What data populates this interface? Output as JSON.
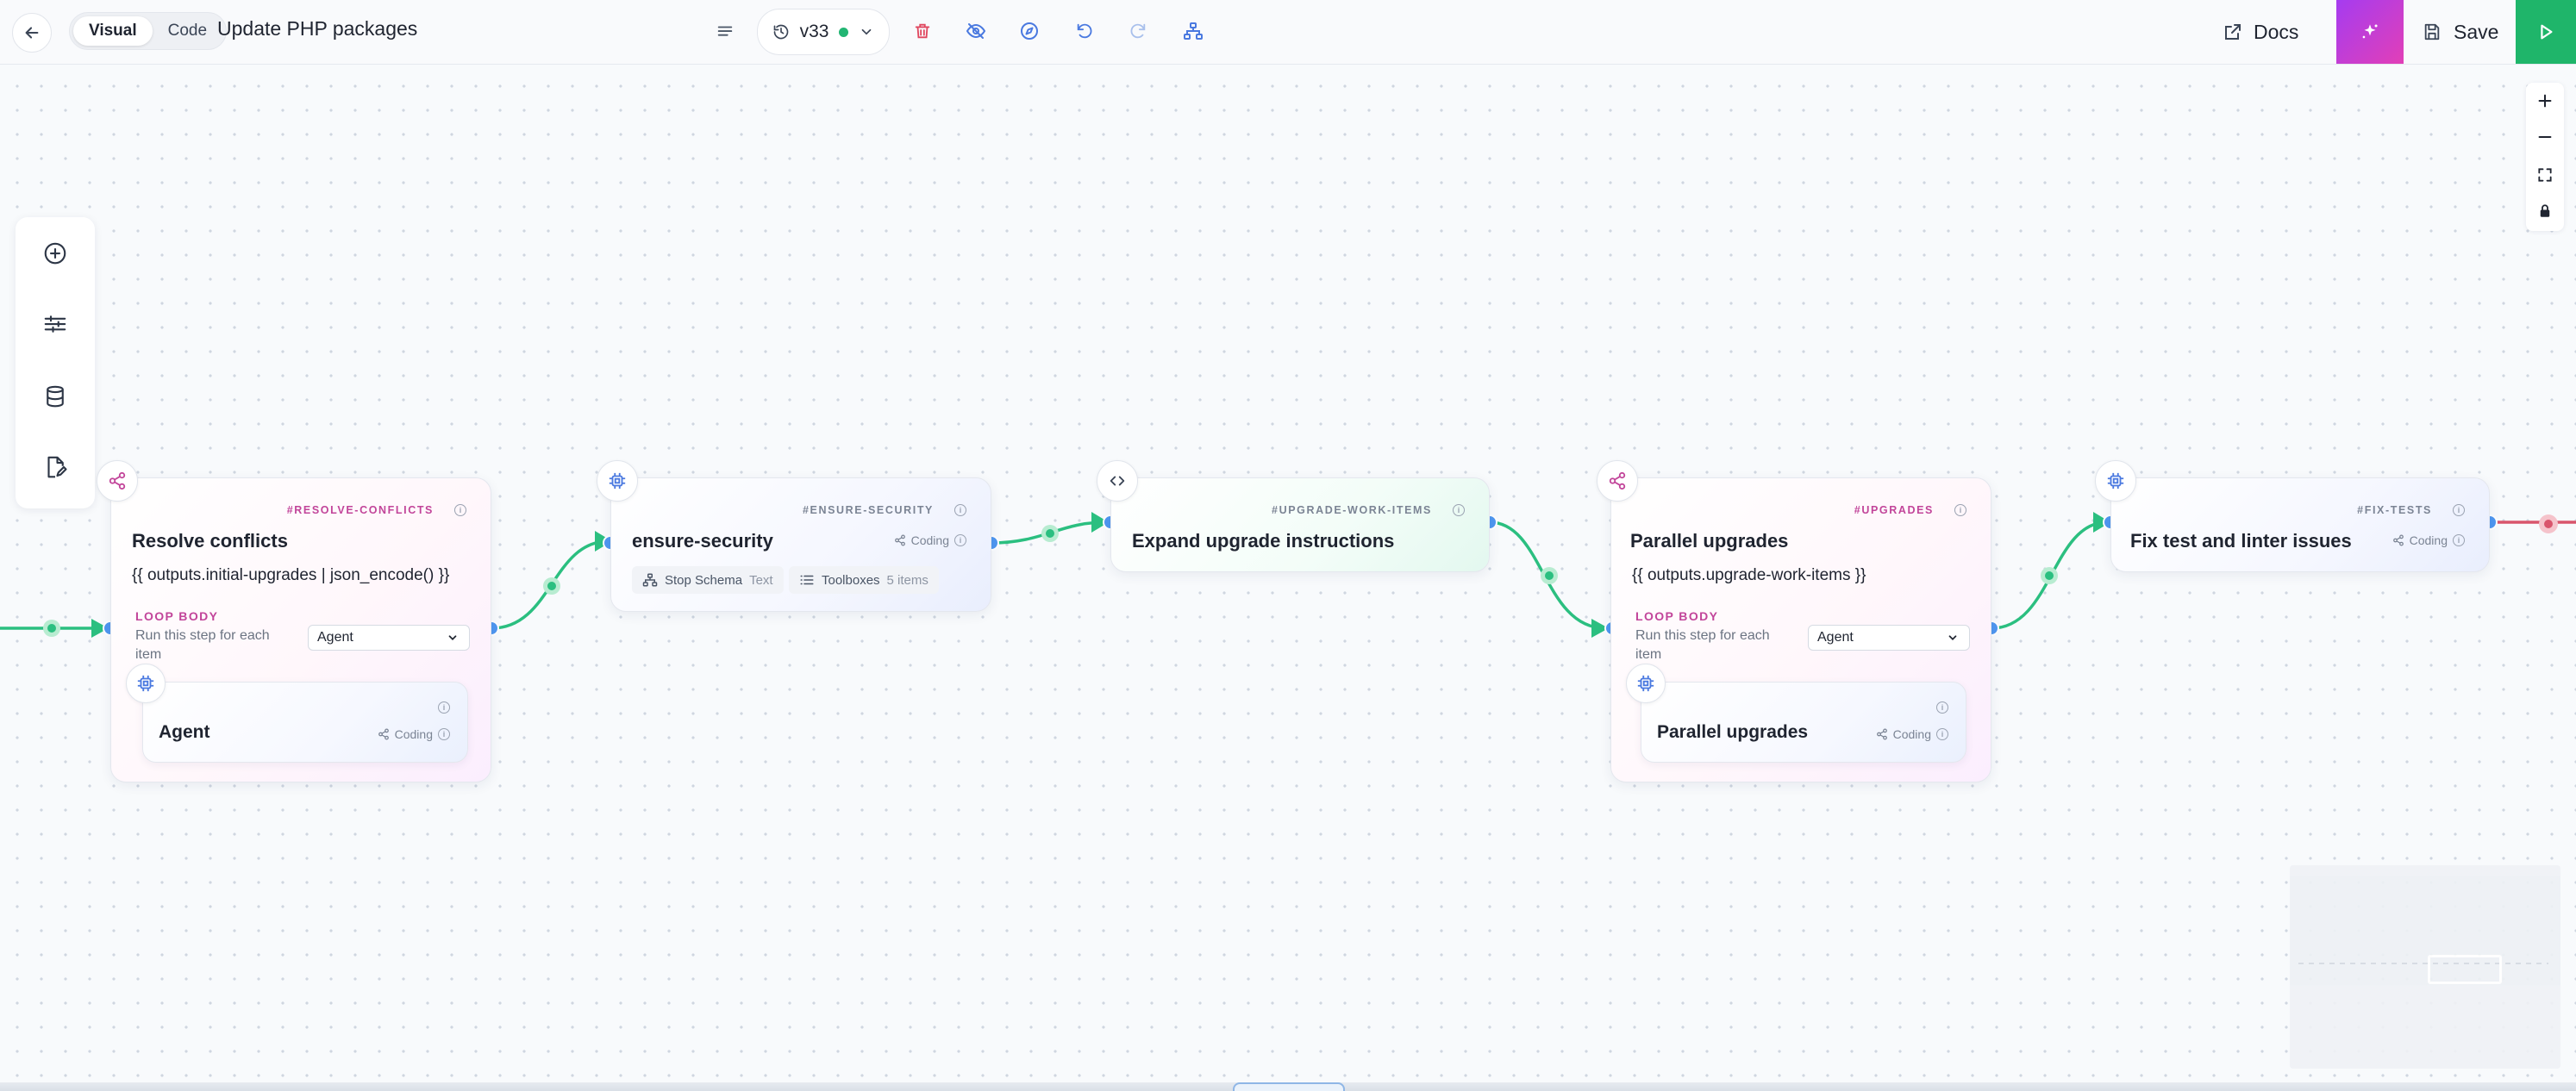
{
  "toolbar": {
    "view_modes": [
      "Visual",
      "Code"
    ],
    "active_view": "Visual",
    "title": "Update PHP packages",
    "version": "v33",
    "docs_label": "Docs",
    "save_label": "Save",
    "status_color": "#22b573",
    "ai_gradient": [
      "#a53cf0",
      "#e23fb7"
    ],
    "run_color": "#1fb56a"
  },
  "left_tools": [
    "add-icon",
    "sliders-icon",
    "database-icon",
    "file-edit-icon"
  ],
  "zoom_controls": [
    "zoom-in-icon",
    "zoom-out-icon",
    "fit-view-icon",
    "lock-icon"
  ],
  "nodes": {
    "resolve_conflicts": {
      "slug": "#RESOLVE-CONFLICTS",
      "title": "Resolve conflicts",
      "expression": "{{ outputs.initial-upgrades | json_encode() }}",
      "loop_label": "LOOP BODY",
      "loop_desc": "Run this step for each item",
      "select_value": "Agent",
      "inner_title": "Agent",
      "inner_tag": "Coding"
    },
    "ensure_security": {
      "slug": "#ENSURE-SECURITY",
      "title": "ensure-security",
      "tag": "Coding",
      "pill1_label": "Stop Schema",
      "pill1_value": "Text",
      "pill2_label": "Toolboxes",
      "pill2_value": "5 items"
    },
    "upgrade_work_items": {
      "slug": "#UPGRADE-WORK-ITEMS",
      "title": "Expand upgrade instructions"
    },
    "upgrades": {
      "slug": "#UPGRADES",
      "title": "Parallel upgrades",
      "expression": "{{ outputs.upgrade-work-items }}",
      "loop_label": "LOOP BODY",
      "loop_desc": "Run this step for each item",
      "select_value": "Agent",
      "inner_title": "Parallel upgrades",
      "inner_tag": "Coding"
    },
    "fix_tests": {
      "slug": "#FIX-TESTS",
      "title": "Fix test and linter issues",
      "tag": "Coding"
    }
  }
}
